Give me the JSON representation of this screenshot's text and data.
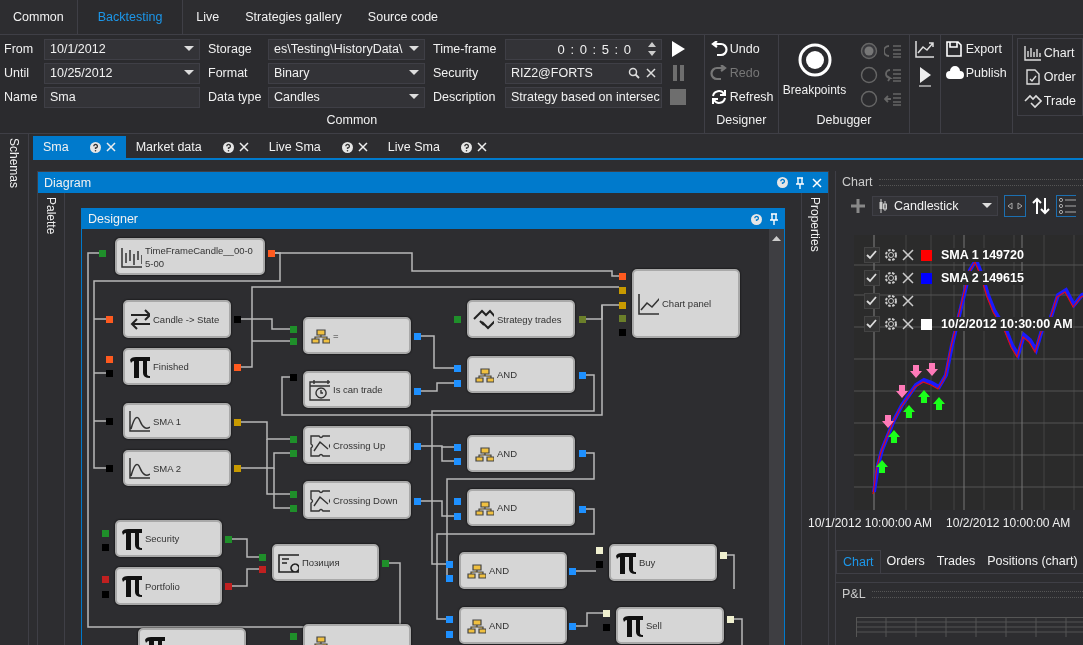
{
  "menu_tabs": [
    {
      "label": "Common",
      "selected": false
    },
    {
      "label": "Backtesting",
      "selected": true
    },
    {
      "label": "Live",
      "selected": false
    },
    {
      "label": "Strategies gallery",
      "selected": false
    },
    {
      "label": "Source code",
      "selected": false
    }
  ],
  "common": {
    "fields": [
      {
        "label": "From",
        "value": "10/1/2012",
        "kind": "dropdown"
      },
      {
        "label": "Until",
        "value": "10/25/2012",
        "kind": "dropdown"
      },
      {
        "label": "Name",
        "value": "Sma",
        "kind": "text"
      },
      {
        "label": "Storage",
        "value": "es\\Testing\\HistoryData\\",
        "kind": "dropdown"
      },
      {
        "label": "Format",
        "value": "Binary",
        "kind": "dropdown"
      },
      {
        "label": "Data type",
        "value": "Candles",
        "kind": "dropdown"
      },
      {
        "label": "Time-frame",
        "value": "0 : 0 : 5 : 0",
        "kind": "spinner"
      },
      {
        "label": "Security",
        "value": "RIZ2@FORTS",
        "kind": "search"
      },
      {
        "label": "Description",
        "value": "Strategy based on intersec",
        "kind": "text"
      }
    ],
    "run_buttons": [
      {
        "kind": "play",
        "disabled": false
      },
      {
        "kind": "pause",
        "disabled": true
      },
      {
        "kind": "stop",
        "disabled": true
      }
    ],
    "label": "Common"
  },
  "designer": {
    "buttons": [
      {
        "label": "Undo",
        "kind": "undo",
        "disabled": false
      },
      {
        "label": "Redo",
        "kind": "redo",
        "disabled": true
      },
      {
        "label": "Refresh",
        "kind": "refresh",
        "disabled": false
      }
    ],
    "label": "Designer"
  },
  "debugger": {
    "breakpoints": "Breakpoints",
    "options": [
      {
        "kind": "step_into",
        "selected": true
      },
      {
        "kind": "step_over",
        "selected": false
      },
      {
        "kind": "step_out",
        "selected": false
      }
    ],
    "label": "Debugger"
  },
  "share": [
    {
      "label": "Export",
      "kind": "export"
    },
    {
      "label": "Publish",
      "kind": "publish"
    }
  ],
  "windows": [
    {
      "label": "Chart",
      "kind": "chart"
    },
    {
      "label": "Order",
      "kind": "order"
    },
    {
      "label": "Trade",
      "kind": "trade"
    }
  ],
  "side_panel": "Schemas",
  "doc_tabs": [
    {
      "label": "Sma",
      "selected": true
    },
    {
      "label": "Market data",
      "selected": false
    },
    {
      "label": "Live Sma",
      "selected": false
    },
    {
      "label": "Live Sma",
      "selected": false
    }
  ],
  "diagram": {
    "title": "Diagram",
    "palette": "Palette",
    "properties": "Properties",
    "designer": {
      "title": "Designer",
      "nodes": [
        {
          "label": "TimeFrameCandle__00-05-00",
          "kind": "candles"
        },
        {
          "label": "Candle -> State",
          "kind": "convert"
        },
        {
          "label": "Finished",
          "kind": "variable"
        },
        {
          "label": "SMA 1",
          "kind": "indicator"
        },
        {
          "label": "SMA 2",
          "kind": "indicator"
        },
        {
          "label": "=",
          "kind": "logic"
        },
        {
          "label": "Is can trade",
          "kind": "time"
        },
        {
          "label": "Crossing Up",
          "kind": "crossing"
        },
        {
          "label": "Crossing Down",
          "kind": "crossing"
        },
        {
          "label": "Strategy trades",
          "kind": "trades"
        },
        {
          "label": "AND",
          "kind": "logic"
        },
        {
          "label": "AND",
          "kind": "logic"
        },
        {
          "label": "AND",
          "kind": "logic"
        },
        {
          "label": "Chart panel",
          "kind": "chart"
        },
        {
          "label": "Security",
          "kind": "variable"
        },
        {
          "label": "Portfolio",
          "kind": "variable"
        },
        {
          "label": "Позиция",
          "kind": "position"
        },
        {
          "label": "AND",
          "kind": "logic"
        },
        {
          "label": "AND",
          "kind": "logic"
        },
        {
          "label": "Buy",
          "kind": "variable"
        },
        {
          "label": "Sell",
          "kind": "variable"
        },
        {
          "kind": "variable"
        },
        {
          "kind": "logic"
        }
      ]
    }
  },
  "chart": {
    "title": "Chart",
    "series_type": "Candlestick",
    "legend": [
      {
        "label": "SMA 1  149720",
        "color": "#ff0000",
        "checked": true
      },
      {
        "label": "SMA 2  149615",
        "color": "#0000ff",
        "checked": true
      },
      {
        "checked": true
      },
      {
        "label": "10/2/2012 10:30:00 AM",
        "color": "#ffffff",
        "checked": true
      }
    ],
    "x_labels": [
      "10/1/2012 10:00:00 AM",
      "10/2/2012 10:00:00 AM"
    ],
    "tabs": [
      {
        "label": "Chart",
        "selected": true
      },
      {
        "label": "Orders",
        "selected": false
      },
      {
        "label": "Trades",
        "selected": false
      },
      {
        "label": "Positions (chart)",
        "selected": false
      }
    ],
    "pnl_title": "P&L"
  }
}
